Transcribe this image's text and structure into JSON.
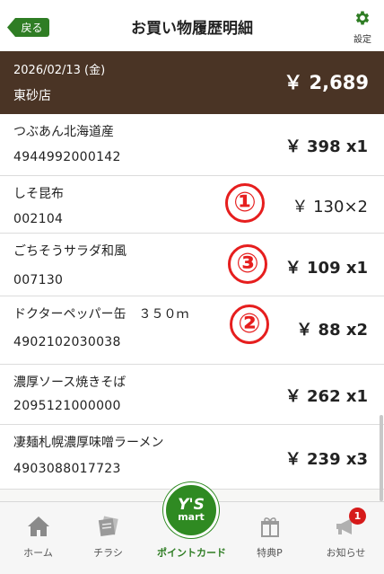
{
  "header": {
    "back_label": "戻る",
    "title": "お買い物履歴明細",
    "settings_label": "設定"
  },
  "receipt": {
    "date": "2026/02/13 (金)",
    "store": "東砂店",
    "total": "￥ 2,689"
  },
  "items": [
    {
      "name": "つぶあん北海道産",
      "code": "4944992000142",
      "price": "￥ 398 x1",
      "annotation": ""
    },
    {
      "name": "しそ昆布",
      "code": "002104",
      "price": "￥ 130×2",
      "annotation": "①"
    },
    {
      "name": "ごちそうサラダ和風",
      "code": "007130",
      "price": "￥ 109 x1",
      "annotation": "③"
    },
    {
      "name": "ドクターペッパー缶　３５０ｍ",
      "code": "4902102030038",
      "price": "￥ 88 x2",
      "annotation": "②"
    },
    {
      "name": "濃厚ソース焼きそば",
      "code": "2095121000000",
      "price": "￥ 262 x1",
      "annotation": ""
    },
    {
      "name": "凄麺札幌濃厚味噌ラーメン",
      "code": "4903088017723",
      "price": "￥ 239 x3",
      "annotation": ""
    }
  ],
  "tabbar": {
    "tabs": [
      {
        "label": "ホーム",
        "icon": "home-icon"
      },
      {
        "label": "チラシ",
        "icon": "flyer-icon"
      },
      {
        "label": "ポイントカード",
        "icon": "ys-mart-logo"
      },
      {
        "label": "特典P",
        "icon": "gift-icon"
      },
      {
        "label": "お知らせ",
        "icon": "megaphone-icon"
      }
    ],
    "logo_top": "Y'S",
    "logo_bottom": "mart",
    "notification_count": "1"
  },
  "colors": {
    "brand_green": "#2f7d24",
    "store_bar": "#4a3425",
    "annotation_red": "#e61e1e",
    "badge_red": "#d61a1a"
  }
}
